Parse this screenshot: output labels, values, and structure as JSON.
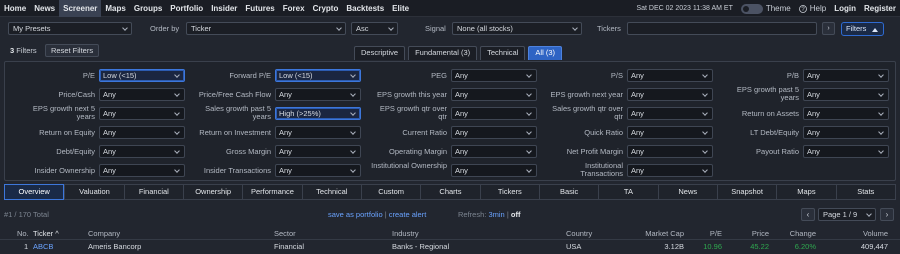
{
  "nav": {
    "items": [
      "Home",
      "News",
      "Screener",
      "Maps",
      "Groups",
      "Portfolio",
      "Insider",
      "Futures",
      "Forex",
      "Crypto",
      "Backtests",
      "Elite"
    ],
    "active_index": 2,
    "datetime": "Sat DEC 02 2023 11:38 AM ET",
    "theme": "Theme",
    "help": "Help",
    "login": "Login",
    "register": "Register"
  },
  "controls": {
    "preset": "My Presets",
    "order_label": "Order by",
    "order_value": "Ticker",
    "direction": "Asc",
    "signal_label": "Signal",
    "signal_value": "None (all stocks)",
    "tickers_label": "Tickers",
    "tickers_value": "",
    "go": "›",
    "filters_btn": "Filters"
  },
  "filter_header": {
    "count_num": "3",
    "count_text": "Filters",
    "reset": "Reset Filters",
    "tabs": [
      "Descriptive",
      "Fundamental (3)",
      "Technical",
      "All (3)"
    ],
    "active_tab": 3
  },
  "filters": [
    {
      "label": "P/E",
      "value": "Low (<15)",
      "hl": true
    },
    {
      "label": "Forward P/E",
      "value": "Low (<15)",
      "hl": true
    },
    {
      "label": "PEG",
      "value": "Any"
    },
    {
      "label": "P/S",
      "value": "Any"
    },
    {
      "label": "P/B",
      "value": "Any"
    },
    {
      "label": "Price/Cash",
      "value": "Any"
    },
    {
      "label": "Price/Free Cash Flow",
      "value": "Any"
    },
    {
      "label": "EPS growth this year",
      "value": "Any"
    },
    {
      "label": "EPS growth next year",
      "value": "Any"
    },
    {
      "label": "EPS growth past 5 years",
      "value": "Any"
    },
    {
      "label": "EPS growth next 5 years",
      "value": "Any"
    },
    {
      "label": "Sales growth past 5 years",
      "value": "High (>25%)",
      "hl": true
    },
    {
      "label": "EPS growth qtr over qtr",
      "value": "Any"
    },
    {
      "label": "Sales growth qtr over qtr",
      "value": "Any"
    },
    {
      "label": "Return on Assets",
      "value": "Any"
    },
    {
      "label": "Return on Equity",
      "value": "Any"
    },
    {
      "label": "Return on Investment",
      "value": "Any"
    },
    {
      "label": "Current Ratio",
      "value": "Any"
    },
    {
      "label": "Quick Ratio",
      "value": "Any"
    },
    {
      "label": "LT Debt/Equity",
      "value": "Any"
    },
    {
      "label": "Debt/Equity",
      "value": "Any"
    },
    {
      "label": "Gross Margin",
      "value": "Any"
    },
    {
      "label": "Operating Margin",
      "value": "Any"
    },
    {
      "label": "Net Profit Margin",
      "value": "Any"
    },
    {
      "label": "Payout Ratio",
      "value": "Any"
    },
    {
      "label": "Insider Ownership",
      "value": "Any"
    },
    {
      "label": "Insider Transactions",
      "value": "Any"
    },
    {
      "label": "Institutional Ownership",
      "value": "Any"
    },
    {
      "label": "Institutional Transactions",
      "value": "Any"
    }
  ],
  "view_tabs": [
    "Overview",
    "Valuation",
    "Financial",
    "Ownership",
    "Performance",
    "Technical",
    "Custom",
    "Charts",
    "Tickers",
    "Basic",
    "TA",
    "News",
    "Snapshot",
    "Maps",
    "Stats"
  ],
  "results": {
    "total": "#1 / 170 Total",
    "save": "save as portfolio",
    "sep": "|",
    "alert": "create alert",
    "refresh_label": "Refresh:",
    "refresh_value": "3min",
    "refresh_sep": "|",
    "refresh_off": "off",
    "prev": "‹",
    "next": "›",
    "page": "Page 1 / 9"
  },
  "table": {
    "headers": [
      "No.",
      "Ticker ^",
      "Company",
      "Sector",
      "Industry",
      "Country",
      "Market Cap",
      "P/E",
      "Price",
      "Change",
      "Volume"
    ],
    "rows": [
      [
        "1",
        "ABCB",
        "Ameris Bancorp",
        "Financial",
        "Banks - Regional",
        "USA",
        "3.12B",
        "10.96",
        "45.22",
        "6.20%",
        "409,447"
      ]
    ]
  },
  "colors": {
    "accent": "#2e64c4",
    "link": "#6aa3ff",
    "positive": "#2fa84f"
  }
}
